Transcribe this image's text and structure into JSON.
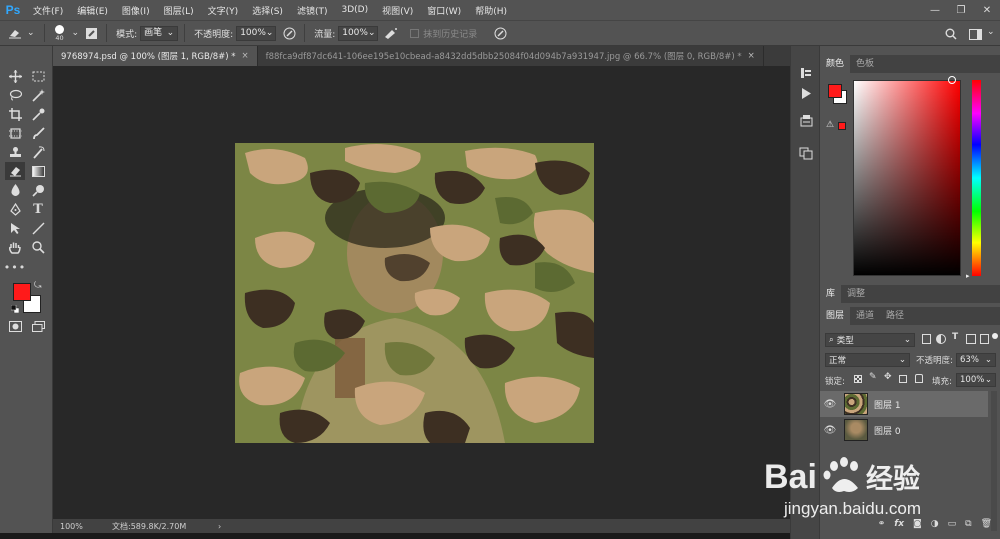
{
  "app": {
    "logo": "Ps"
  },
  "menu": [
    "文件(F)",
    "编辑(E)",
    "图像(I)",
    "图层(L)",
    "文字(Y)",
    "选择(S)",
    "滤镜(T)",
    "3D(D)",
    "视图(V)",
    "窗口(W)",
    "帮助(H)"
  ],
  "window_controls": {
    "minimize": "—",
    "restore": "❐",
    "close": "✕"
  },
  "options": {
    "brush_size": "40",
    "mode_label": "模式:",
    "mode_value": "画笔",
    "opacity_label": "不透明度:",
    "opacity_value": "100%",
    "flow_label": "流量:",
    "flow_value": "100%",
    "erase_history_label": "抹到历史记录"
  },
  "tabs": [
    {
      "label": "9768974.psd @ 100% (图层 1, RGB/8#) *",
      "close": "×"
    },
    {
      "label": "f88fca9df87dc641-106ee195e10cbead-a8432dd5dbb25084f04d094b7a931947.jpg @ 66.7% (图层 0, RGB/8#) *",
      "close": "×"
    }
  ],
  "status": {
    "zoom": "100%",
    "doc_info": "文档:589.8K/2.70M",
    "arrow": "›"
  },
  "color_panel": {
    "tab_color": "颜色",
    "tab_swatches": "色板"
  },
  "lib_panel": {
    "tab_library": "库",
    "tab_adjust": "调整"
  },
  "layers_panel": {
    "tab_layers": "图层",
    "tab_channels": "通道",
    "tab_paths": "路径",
    "filter_kind": "类型",
    "blend_mode": "正常",
    "opacity_label": "不透明度:",
    "opacity_value": "63%",
    "lock_label": "锁定:",
    "fill_label": "填充:",
    "fill_value": "100%",
    "layers": [
      {
        "name": "图层 1",
        "selected": true
      },
      {
        "name": "图层 0",
        "selected": false
      }
    ],
    "footer_icons": [
      "link-icon",
      "fx-icon",
      "mask-icon",
      "adjustment-icon",
      "folder-icon",
      "new-layer-icon",
      "trash-icon"
    ]
  },
  "colors": {
    "foreground": "#ff1a1a",
    "background": "#ffffff",
    "accent": "#31a8ff"
  },
  "watermark": {
    "brand_text": "Bai",
    "brand_cn": "经验",
    "url": "jingyan.baidu.com"
  }
}
